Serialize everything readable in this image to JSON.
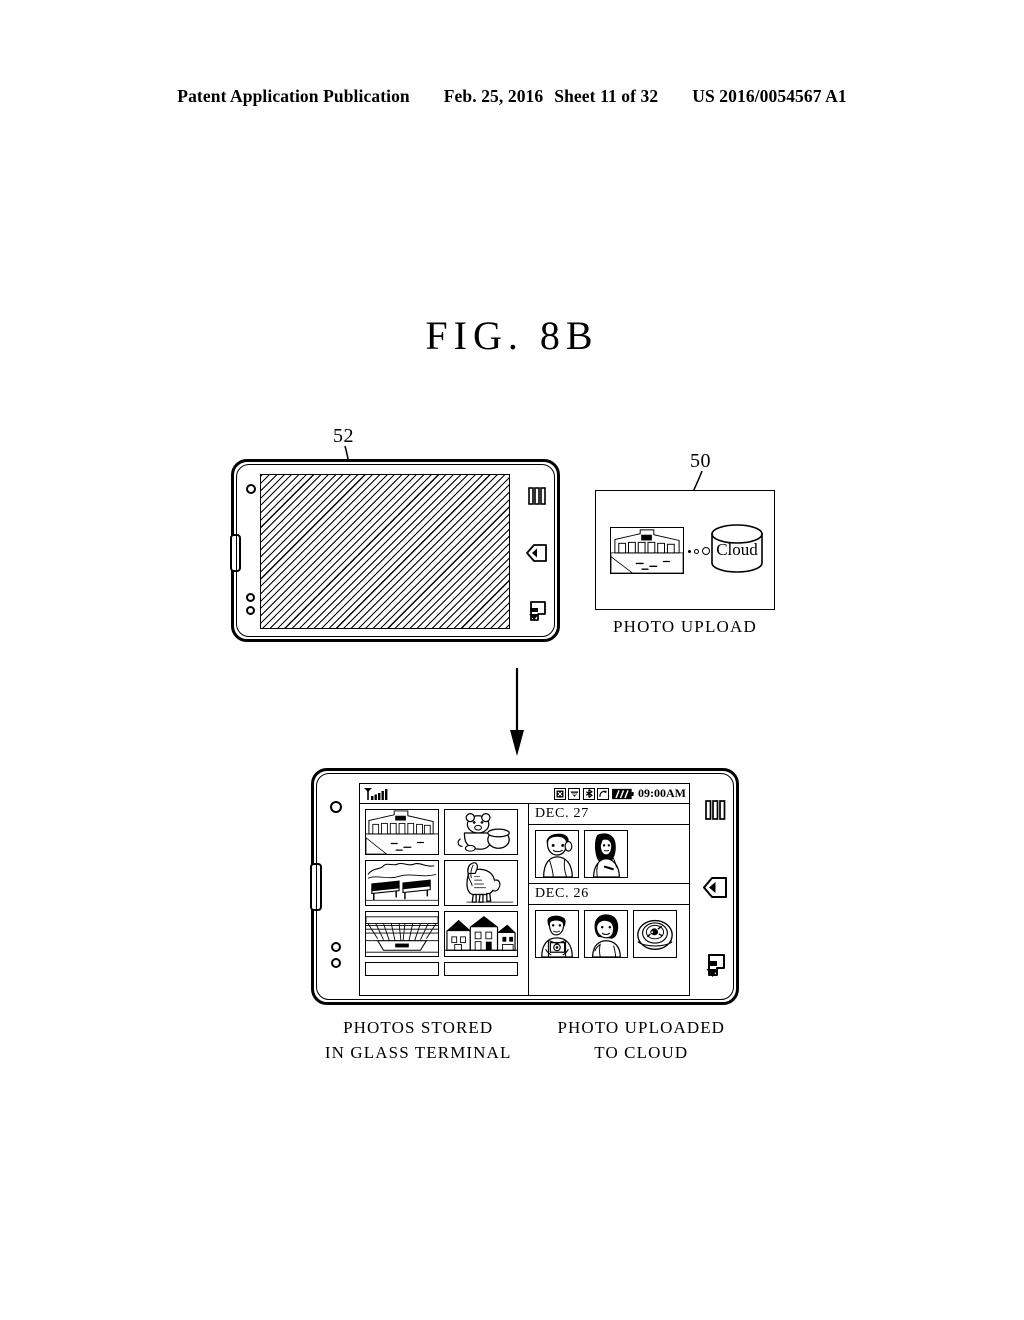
{
  "header": {
    "publication": "Patent Application Publication",
    "date": "Feb. 25, 2016",
    "sheet": "Sheet 11 of 32",
    "docnum": "US 2016/0054567 A1"
  },
  "figure": {
    "title": "FIG.  8B"
  },
  "refs": {
    "top_device": "52",
    "upload_box": "50"
  },
  "upload_panel": {
    "cloud_label": "Cloud",
    "caption": "PHOTO UPLOAD",
    "photo_alt": "building-photo",
    "dots": 3
  },
  "terminal": {
    "status_bar": {
      "signal_icon": "signal-bars-icon",
      "icons": [
        "alarm-icon",
        "wifi-icon",
        "bluetooth-icon",
        "sync-icon"
      ],
      "battery_icon": "battery-icon",
      "time": "09:00AM"
    },
    "grid_pane": {
      "thumbnails": [
        "building-photo",
        "teddy-bear-photo",
        "park-bench-photo",
        "horse-photo",
        "stadium-photo",
        "houses-photo",
        "partial-photo-left",
        "partial-photo-right"
      ]
    },
    "date_groups": [
      {
        "label": "DEC. 27",
        "thumbnails": [
          "person-cap-photo",
          "woman-photo"
        ]
      },
      {
        "label": "DEC. 26",
        "thumbnails": [
          "man-camera-photo",
          "woman-hat-photo",
          "food-plate-photo"
        ]
      }
    ],
    "nav_icons": [
      "menu-icon",
      "home-icon",
      "back-icon"
    ]
  },
  "captions": {
    "left": {
      "line1": "PHOTOS STORED",
      "line2": "IN GLASS TERMINAL"
    },
    "right": {
      "line1": "PHOTO UPLOADED",
      "line2": "TO CLOUD"
    }
  },
  "colors": {
    "ink": "#000000",
    "paper": "#ffffff"
  }
}
